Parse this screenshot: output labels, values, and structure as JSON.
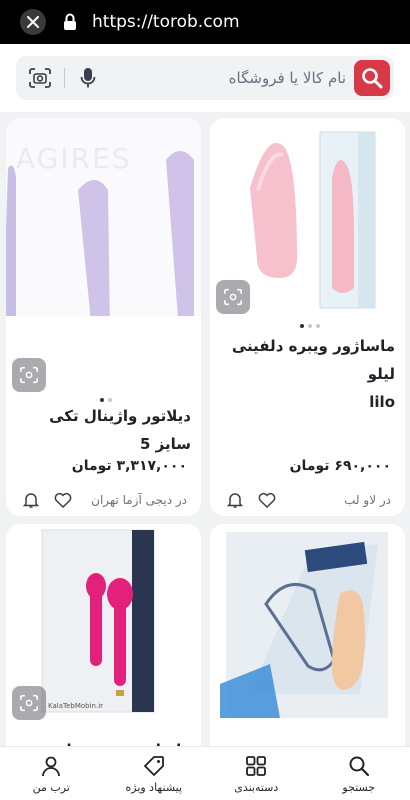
{
  "browser": {
    "url": "https://torob.com",
    "close_icon": "close-icon",
    "lock_icon": "lock-icon"
  },
  "search": {
    "placeholder": "نام کالا یا فروشگاه",
    "logo_icon": "torob-logo-icon",
    "mic_icon": "mic-icon",
    "camera_icon": "camera-search-icon",
    "accent_color": "#d73948"
  },
  "products": [
    {
      "title_line1": "ماساژور ویبره دلفینی لیلو",
      "title_line2": "lilo",
      "price": "۶۹۰,۰۰۰ تومان",
      "shop": "در لاو لب"
    },
    {
      "title_line1": "دیلاتور واژینال تکی سایز 5",
      "title_line2": "",
      "price": "۳,۳۱۷,۰۰۰ تومان",
      "shop": "در دیجی آزما تهران"
    },
    {
      "image_text": "",
      "title_line1": ""
    },
    {
      "image_text": "KalaTebMobin.ir",
      "title_line1": "ماساژور ویبره دار ..."
    }
  ],
  "bottom_nav": [
    {
      "label": "جستجو",
      "icon": "search-icon"
    },
    {
      "label": "دسته‌بندی",
      "icon": "grid-icon"
    },
    {
      "label": "پیشنهاد ویژه",
      "icon": "tag-icon"
    },
    {
      "label": "ترب من",
      "icon": "user-icon"
    }
  ]
}
